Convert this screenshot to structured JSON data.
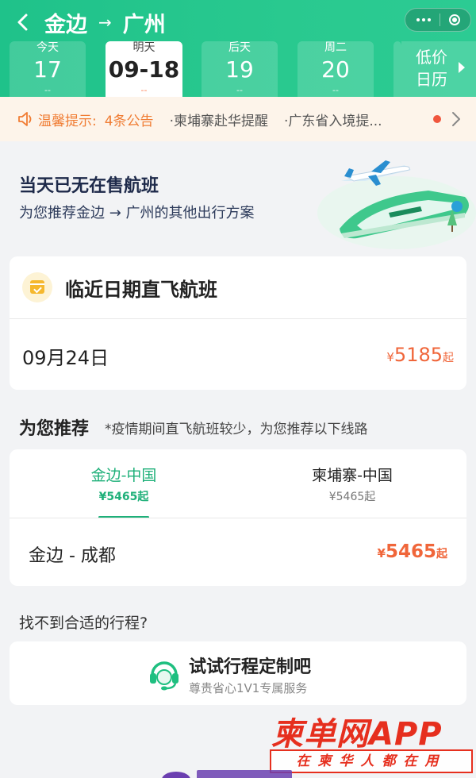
{
  "header": {
    "from": "金边",
    "to": "广州",
    "arrow": "→",
    "accent_color": "#1fc28a"
  },
  "dates": [
    {
      "label": "今天",
      "num": "17",
      "dash": "--"
    },
    {
      "label": "明天",
      "num": "09-18",
      "dash": "--",
      "active": true
    },
    {
      "label": "后天",
      "num": "19",
      "dash": "--"
    },
    {
      "label": "周二",
      "num": "20",
      "dash": "--"
    }
  ],
  "low_price": {
    "line1": "低价",
    "line2": "日历"
  },
  "notice": {
    "tip": "温馨提示:",
    "count": "4条公告",
    "items": [
      "·柬埔寨赴华提醒",
      "·广东省入境提..."
    ]
  },
  "hero": {
    "title": "当天已无在售航班",
    "subtitle": "为您推荐金边 → 广州的其他出行方案"
  },
  "nearby": {
    "title": "临近日期直飞航班",
    "date": "09月24日",
    "price_symbol": "¥",
    "price": "5185",
    "price_suffix": "起"
  },
  "recommend": {
    "title": "为您推荐",
    "note": "*疫情期间直飞航班较少，为您推荐以下线路",
    "tabs": [
      {
        "title": "金边-中国",
        "price": "¥5465起",
        "active": true
      },
      {
        "title": "柬埔寨-中国",
        "price": "¥5465起"
      }
    ],
    "route": "金边 - 成都",
    "price_symbol": "¥",
    "price": "5465",
    "price_suffix": "起"
  },
  "custom": {
    "question": "找不到合适的行程?",
    "title": "试试行程定制吧",
    "subtitle": "尊贵省心1V1专属服务"
  },
  "watermark": {
    "big": "柬单网APP",
    "small": "在柬华人都在用"
  }
}
